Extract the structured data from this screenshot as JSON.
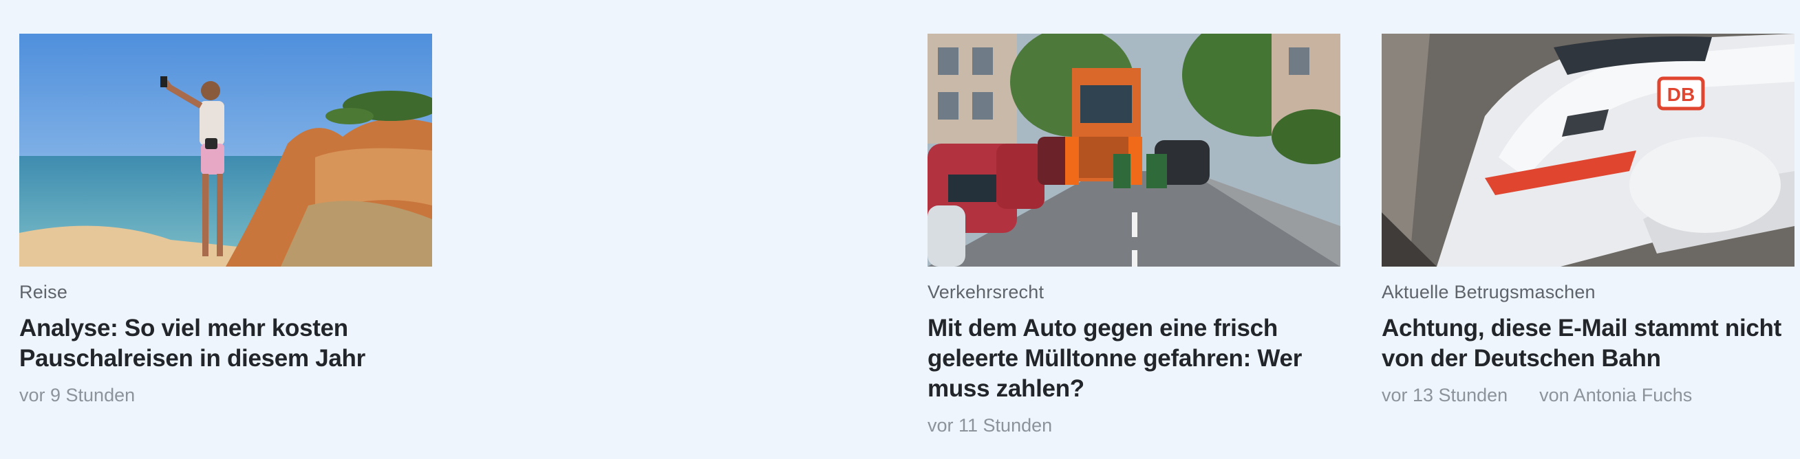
{
  "articles": [
    {
      "kicker": "Reise",
      "headline": "Analyse: So viel mehr kosten Pauschalreisen in diesem Jahr",
      "time": "vor 9 Stunden",
      "author": "",
      "image": "beach-selfie-photo"
    },
    {
      "kicker": "Verkehrsrecht",
      "headline": "Mit dem Auto gegen eine frisch geleerte Mülltonne gefahren: Wer muss zahlen?",
      "time": "vor 11 Stunden",
      "author": "",
      "image": "garbage-truck-street-photo"
    },
    {
      "kicker": "Aktuelle Betrugsmaschen",
      "headline": "Achtung, diese E-Mail stammt nicht von der Deutschen Bahn",
      "time": "vor 13 Stunden",
      "author": "von Antonia Fuchs",
      "image": "db-ice-train-photo",
      "logo_text": "DB"
    }
  ]
}
